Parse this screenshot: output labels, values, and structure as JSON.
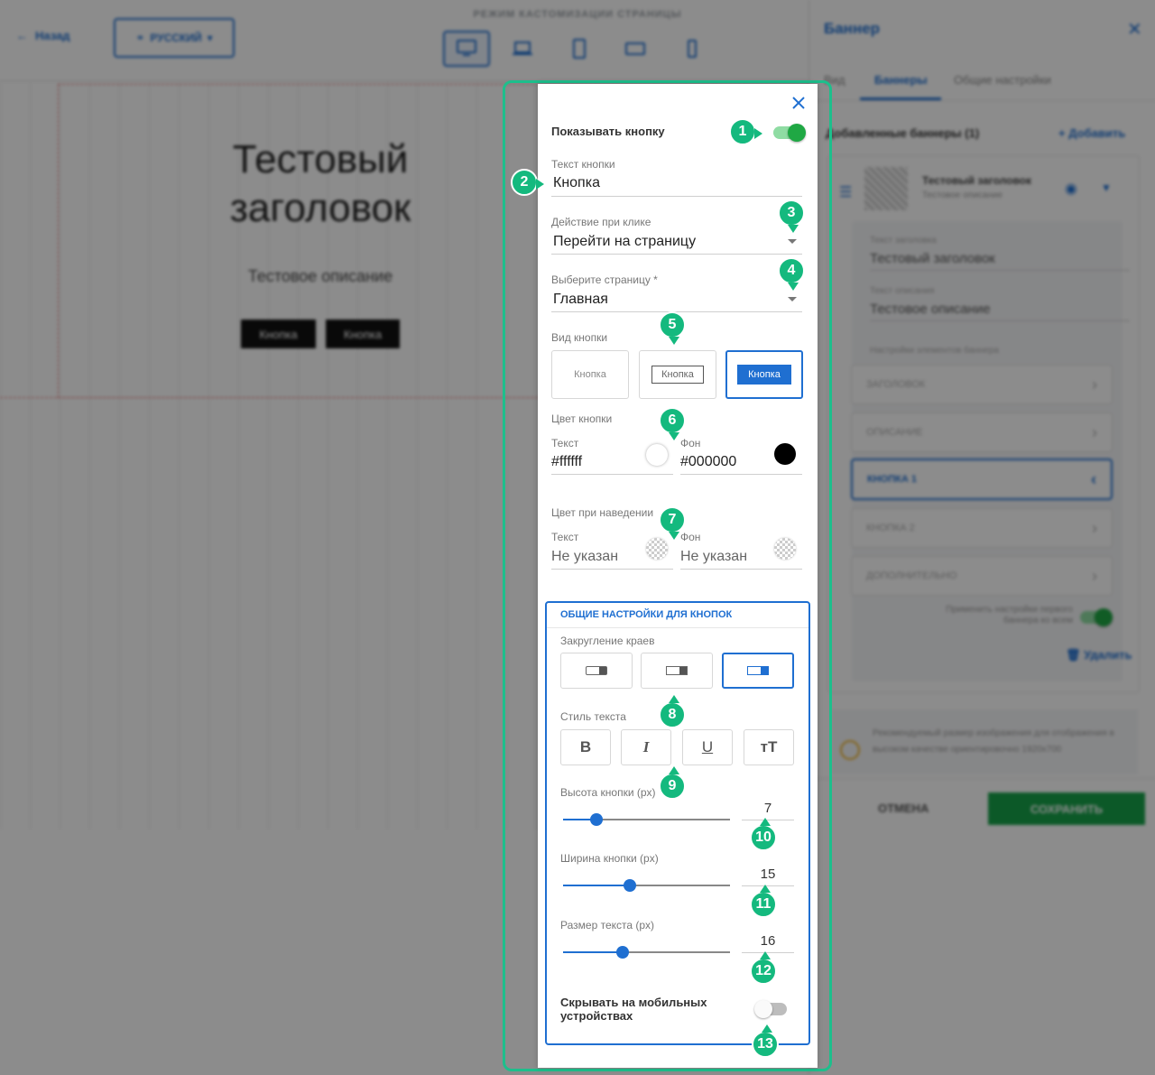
{
  "builder": {
    "back_label": "Назад",
    "language_label": "РУССКИЙ",
    "mode_title": "РЕЖИМ КАСТОМИЗАЦИИ СТРАНИЦЫ",
    "devices": [
      "desktop-icon",
      "laptop-icon",
      "tablet-icon",
      "tablet-landscape-icon",
      "mobile-icon"
    ],
    "banner_title": "Тестовый заголовок",
    "banner_description": "Тестовое описание",
    "banner_buttons": [
      "Кнопка",
      "Кнопка"
    ]
  },
  "right_panel": {
    "title": "Баннер",
    "tabs": [
      "Вид",
      "Баннеры",
      "Общие настройки"
    ],
    "added_label": "Добавленные баннеры (1)",
    "add_label": "Добавить",
    "card_title": "Тестовый заголовок",
    "card_subtitle": "Тестовое описание",
    "field_title_label": "Текст заголовка",
    "field_title_value": "Тестовый заголовок",
    "field_desc_label": "Текст описания",
    "field_desc_value": "Тестовое описание",
    "elements_label": "Настройки элементов баннера",
    "sections": [
      "ЗАГОЛОВОК",
      "ОПИСАНИЕ",
      "КНОПКА 1",
      "КНОПКА 2",
      "ДОПОЛНИТЕЛЬНО"
    ],
    "apply_label": "Применить настройки первого баннера ко всем",
    "delete_label": "Удалить",
    "recommendation": "Рекомендуемый размер изображения для отображения в высоком качестве ориентировочно 1920x700",
    "cancel_label": "ОТМЕНА",
    "save_label": "СОХРАНИТЬ"
  },
  "popup": {
    "show_button_label": "Показывать кнопку",
    "show_button_on": true,
    "button_text_label": "Текст кнопки",
    "button_text_value": "Кнопка",
    "click_action_label": "Действие при клике",
    "click_action_value": "Перейти на страницу",
    "select_page_label": "Выберите страницу *",
    "select_page_value": "Главная",
    "button_view_label": "Вид кнопки",
    "view_options": [
      "Кнопка",
      "Кнопка",
      "Кнопка"
    ],
    "button_color_label": "Цвет кнопки",
    "text_label": "Текст",
    "bg_label": "Фон",
    "text_color": "#ffffff",
    "bg_color": "#000000",
    "hover_color_label": "Цвет при наведении",
    "hover_text_value": "Не указан",
    "hover_bg_value": "Не указан",
    "general_title": "ОБЩИЕ НАСТРОЙКИ ДЛЯ КНОПОК",
    "rounding_label": "Закругление краев",
    "text_style_label": "Стиль текста",
    "style_buttons": [
      "B",
      "I",
      "U",
      "тT"
    ],
    "height_label": "Высота кнопки (px)",
    "height_value": "7",
    "width_label": "Ширина кнопки (px)",
    "width_value": "15",
    "font_size_label": "Размер текста (px)",
    "font_size_value": "16",
    "hide_mobile_label": "Скрывать на мобильных устройствах",
    "hide_mobile_on": false
  },
  "markers": [
    "1",
    "2",
    "3",
    "4",
    "5",
    "6",
    "7",
    "8",
    "9",
    "10",
    "11",
    "12",
    "13"
  ],
  "colors": {
    "accent": "#1f6fd1",
    "callout": "#14b97e",
    "toggle_on": "#1fa844",
    "save": "#17a34a"
  }
}
